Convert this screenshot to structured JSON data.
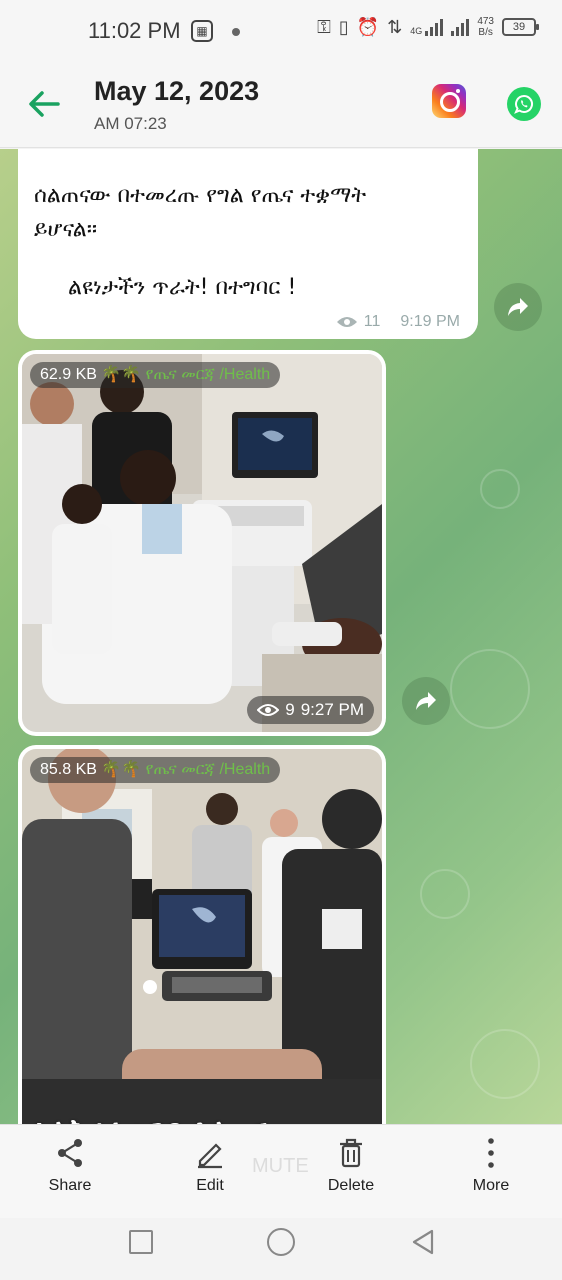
{
  "status_bar": {
    "time": "11:02 PM",
    "network_type": "4G",
    "net_speed_value": "473",
    "net_speed_unit": "B/s",
    "battery": "39"
  },
  "header": {
    "title": "May 12, 2023",
    "subtitle": "AM 07:23",
    "back_icon": "arrow-left-icon",
    "app_icons": [
      "instagram-icon",
      "whatsapp-icon"
    ]
  },
  "messages": [
    {
      "type": "text",
      "line1": "ሰልጠናው በተመረጡ የግል የጤና ተቋማት",
      "line2": "ይሆናል፡፡",
      "line3": "ልዩነታችን ጥራት!  በተግባር !",
      "views": "11",
      "time": "9:19 PM"
    },
    {
      "type": "photo",
      "size": "62.9 KB",
      "tag": "🌴🌴 የጤና መርጃ /Health",
      "views": "9",
      "time": "9:27 PM"
    },
    {
      "type": "photo",
      "size": "85.8 KB",
      "tag": "🌴🌴 የጤና መርጃ /Health",
      "caption": "አልትራሳውንድ ስልጠና"
    }
  ],
  "actions": {
    "share": "Share",
    "edit": "Edit",
    "delete": "Delete",
    "more": "More",
    "ghost": "MUTE"
  },
  "colors": {
    "accent_green": "#1aa260",
    "tag_green": "#6fbf4a"
  }
}
